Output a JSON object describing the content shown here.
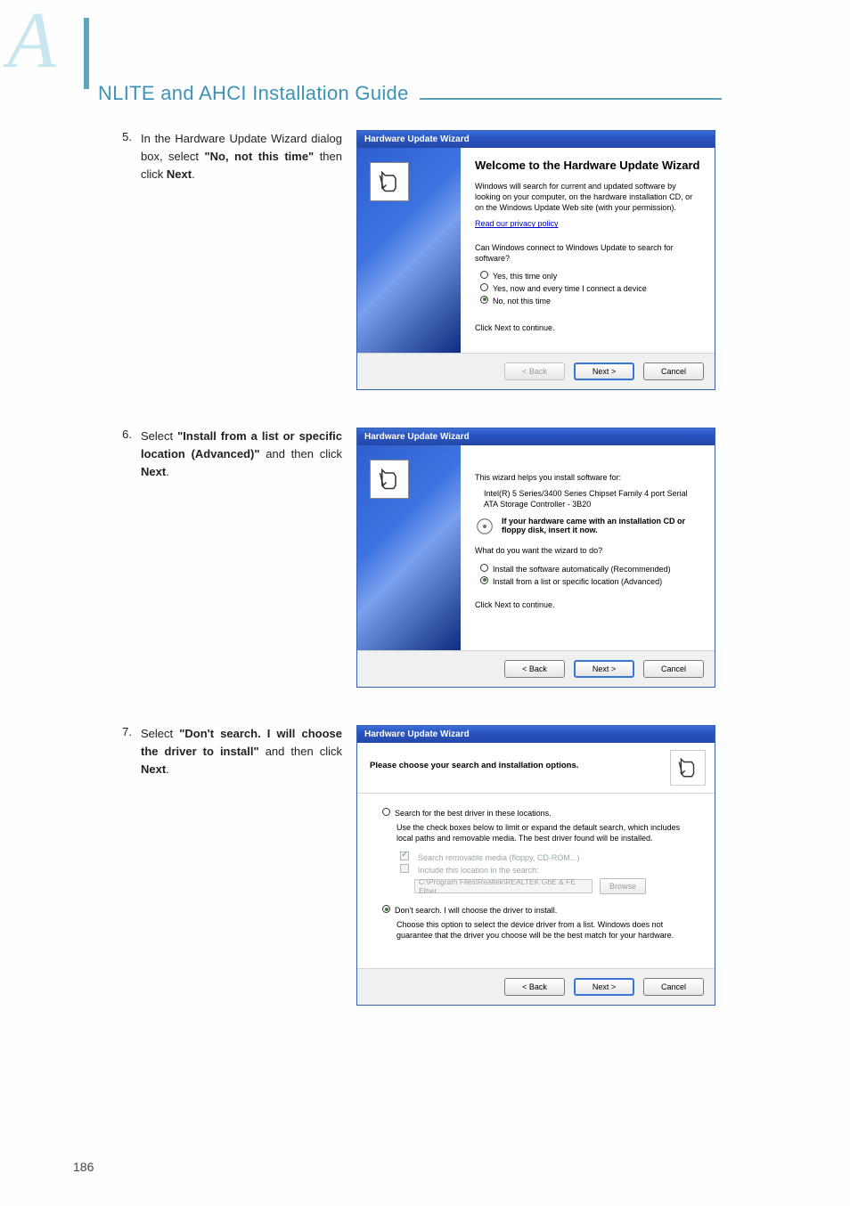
{
  "corner_letter": "A",
  "header_title": "NLITE and AHCI Installation Guide",
  "page_number": "186",
  "steps": [
    {
      "num": "5.",
      "text_pre": "In the Hardware Update Wizard dialog box, select ",
      "bold": "\"No, not this time\"",
      "text_mid": " then click ",
      "bold2": "Next",
      "text_post": "."
    },
    {
      "num": "6.",
      "text_pre": "Select ",
      "bold": "\"Install from a list or specific location (Advanced)\"",
      "text_mid": " and then click ",
      "bold2": "Next",
      "text_post": "."
    },
    {
      "num": "7.",
      "text_pre": "Select ",
      "bold": "\"Don't search. I will choose the driver to install\"",
      "text_mid": " and then click ",
      "bold2": "Next",
      "text_post": "."
    }
  ],
  "wiz_title": "Hardware Update Wizard",
  "wiz1": {
    "h1": "Welcome to the Hardware Update Wizard",
    "p1": "Windows will search for current and updated software by looking on your computer, on the hardware installation CD, or on the Windows Update Web site (with your permission).",
    "link": "Read our privacy policy",
    "p2": "Can Windows connect to Windows Update to search for software?",
    "opt1": "Yes, this time only",
    "opt2": "Yes, now and every time I connect a device",
    "opt3": "No, not this time",
    "cont": "Click Next to continue."
  },
  "wiz2": {
    "lead": "This wizard helps you install software for:",
    "device": "Intel(R) 5 Series/3400 Series Chipset Family 4 port Serial ATA Storage Controller - 3B20",
    "cd": "If your hardware came with an installation CD or floppy disk, insert it now.",
    "q": "What do you want the wizard to do?",
    "opt1": "Install the software automatically (Recommended)",
    "opt2": "Install from a list or specific location (Advanced)",
    "cont": "Click Next to continue."
  },
  "wiz3": {
    "head": "Please choose your search and installation options.",
    "opt1": "Search for the best driver in these locations.",
    "opt1_desc": "Use the check boxes below to limit or expand the default search, which includes local paths and removable media. The best driver found will be installed.",
    "chk1": "Search removable media (floppy, CD-ROM...)",
    "chk2": "Include this location in the search:",
    "path": "C:\\Program Files\\Realtek\\REALTEK GbE & FE Ether",
    "browse": "Browse",
    "opt2": "Don't search. I will choose the driver to install.",
    "opt2_desc": "Choose this option to select the device driver from a list.  Windows does not guarantee that the driver you choose will be the best match for your hardware."
  },
  "btns": {
    "back": "< Back",
    "next": "Next >",
    "cancel": "Cancel"
  }
}
